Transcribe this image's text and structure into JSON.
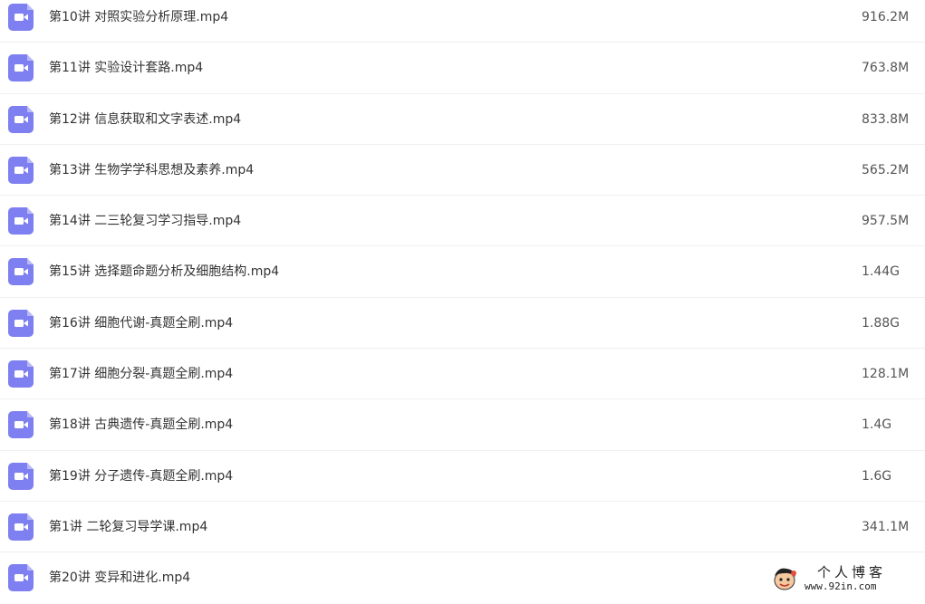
{
  "files": [
    {
      "name": "第10讲 对照实验分析原理.mp4",
      "size": "916.2M",
      "icon": "video-file-icon"
    },
    {
      "name": "第11讲 实验设计套路.mp4",
      "size": "763.8M",
      "icon": "video-file-icon"
    },
    {
      "name": "第12讲 信息获取和文字表述.mp4",
      "size": "833.8M",
      "icon": "video-file-icon"
    },
    {
      "name": "第13讲 生物学学科思想及素养.mp4",
      "size": "565.2M",
      "icon": "video-file-icon"
    },
    {
      "name": "第14讲 二三轮复习学习指导.mp4",
      "size": "957.5M",
      "icon": "video-file-icon"
    },
    {
      "name": "第15讲 选择题命题分析及细胞结构.mp4",
      "size": "1.44G",
      "icon": "video-file-icon"
    },
    {
      "name": "第16讲 细胞代谢-真题全刷.mp4",
      "size": "1.88G",
      "icon": "video-file-icon"
    },
    {
      "name": "第17讲 细胞分裂-真题全刷.mp4",
      "size": "128.1M",
      "icon": "video-file-icon"
    },
    {
      "name": "第18讲 古典遗传-真题全刷.mp4",
      "size": "1.4G",
      "icon": "video-file-icon"
    },
    {
      "name": "第19讲 分子遗传-真题全刷.mp4",
      "size": "1.6G",
      "icon": "video-file-icon"
    },
    {
      "name": "第1讲 二轮复习导学课.mp4",
      "size": "341.1M",
      "icon": "video-file-icon"
    },
    {
      "name": "第20讲 变异和进化.mp4",
      "size": "",
      "icon": "video-file-icon"
    }
  ],
  "watermark": {
    "title": "个人博客",
    "url": "www.92in.com"
  },
  "colors": {
    "icon": "#7e7ff0",
    "text": "#333333",
    "divider": "#f0f0f0"
  }
}
